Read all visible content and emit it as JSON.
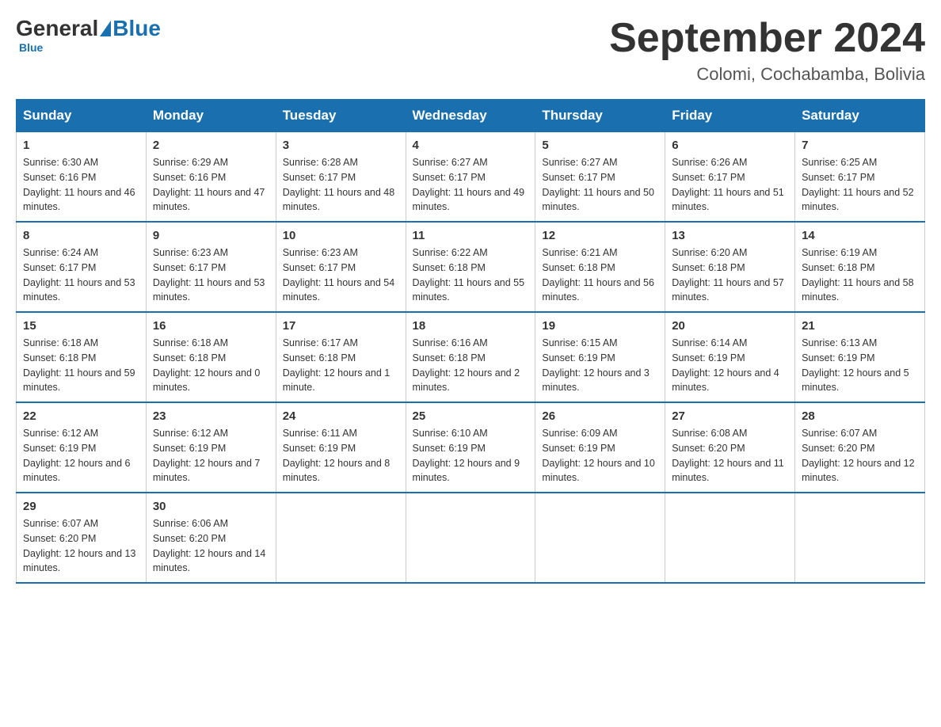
{
  "header": {
    "logo": {
      "general": "General",
      "blue": "Blue"
    },
    "title": "September 2024",
    "subtitle": "Colomi, Cochabamba, Bolivia"
  },
  "columns": [
    "Sunday",
    "Monday",
    "Tuesday",
    "Wednesday",
    "Thursday",
    "Friday",
    "Saturday"
  ],
  "weeks": [
    [
      {
        "day": "1",
        "sunrise": "6:30 AM",
        "sunset": "6:16 PM",
        "daylight": "11 hours and 46 minutes."
      },
      {
        "day": "2",
        "sunrise": "6:29 AM",
        "sunset": "6:16 PM",
        "daylight": "11 hours and 47 minutes."
      },
      {
        "day": "3",
        "sunrise": "6:28 AM",
        "sunset": "6:17 PM",
        "daylight": "11 hours and 48 minutes."
      },
      {
        "day": "4",
        "sunrise": "6:27 AM",
        "sunset": "6:17 PM",
        "daylight": "11 hours and 49 minutes."
      },
      {
        "day": "5",
        "sunrise": "6:27 AM",
        "sunset": "6:17 PM",
        "daylight": "11 hours and 50 minutes."
      },
      {
        "day": "6",
        "sunrise": "6:26 AM",
        "sunset": "6:17 PM",
        "daylight": "11 hours and 51 minutes."
      },
      {
        "day": "7",
        "sunrise": "6:25 AM",
        "sunset": "6:17 PM",
        "daylight": "11 hours and 52 minutes."
      }
    ],
    [
      {
        "day": "8",
        "sunrise": "6:24 AM",
        "sunset": "6:17 PM",
        "daylight": "11 hours and 53 minutes."
      },
      {
        "day": "9",
        "sunrise": "6:23 AM",
        "sunset": "6:17 PM",
        "daylight": "11 hours and 53 minutes."
      },
      {
        "day": "10",
        "sunrise": "6:23 AM",
        "sunset": "6:17 PM",
        "daylight": "11 hours and 54 minutes."
      },
      {
        "day": "11",
        "sunrise": "6:22 AM",
        "sunset": "6:18 PM",
        "daylight": "11 hours and 55 minutes."
      },
      {
        "day": "12",
        "sunrise": "6:21 AM",
        "sunset": "6:18 PM",
        "daylight": "11 hours and 56 minutes."
      },
      {
        "day": "13",
        "sunrise": "6:20 AM",
        "sunset": "6:18 PM",
        "daylight": "11 hours and 57 minutes."
      },
      {
        "day": "14",
        "sunrise": "6:19 AM",
        "sunset": "6:18 PM",
        "daylight": "11 hours and 58 minutes."
      }
    ],
    [
      {
        "day": "15",
        "sunrise": "6:18 AM",
        "sunset": "6:18 PM",
        "daylight": "11 hours and 59 minutes."
      },
      {
        "day": "16",
        "sunrise": "6:18 AM",
        "sunset": "6:18 PM",
        "daylight": "12 hours and 0 minutes."
      },
      {
        "day": "17",
        "sunrise": "6:17 AM",
        "sunset": "6:18 PM",
        "daylight": "12 hours and 1 minute."
      },
      {
        "day": "18",
        "sunrise": "6:16 AM",
        "sunset": "6:18 PM",
        "daylight": "12 hours and 2 minutes."
      },
      {
        "day": "19",
        "sunrise": "6:15 AM",
        "sunset": "6:19 PM",
        "daylight": "12 hours and 3 minutes."
      },
      {
        "day": "20",
        "sunrise": "6:14 AM",
        "sunset": "6:19 PM",
        "daylight": "12 hours and 4 minutes."
      },
      {
        "day": "21",
        "sunrise": "6:13 AM",
        "sunset": "6:19 PM",
        "daylight": "12 hours and 5 minutes."
      }
    ],
    [
      {
        "day": "22",
        "sunrise": "6:12 AM",
        "sunset": "6:19 PM",
        "daylight": "12 hours and 6 minutes."
      },
      {
        "day": "23",
        "sunrise": "6:12 AM",
        "sunset": "6:19 PM",
        "daylight": "12 hours and 7 minutes."
      },
      {
        "day": "24",
        "sunrise": "6:11 AM",
        "sunset": "6:19 PM",
        "daylight": "12 hours and 8 minutes."
      },
      {
        "day": "25",
        "sunrise": "6:10 AM",
        "sunset": "6:19 PM",
        "daylight": "12 hours and 9 minutes."
      },
      {
        "day": "26",
        "sunrise": "6:09 AM",
        "sunset": "6:19 PM",
        "daylight": "12 hours and 10 minutes."
      },
      {
        "day": "27",
        "sunrise": "6:08 AM",
        "sunset": "6:20 PM",
        "daylight": "12 hours and 11 minutes."
      },
      {
        "day": "28",
        "sunrise": "6:07 AM",
        "sunset": "6:20 PM",
        "daylight": "12 hours and 12 minutes."
      }
    ],
    [
      {
        "day": "29",
        "sunrise": "6:07 AM",
        "sunset": "6:20 PM",
        "daylight": "12 hours and 13 minutes."
      },
      {
        "day": "30",
        "sunrise": "6:06 AM",
        "sunset": "6:20 PM",
        "daylight": "12 hours and 14 minutes."
      },
      null,
      null,
      null,
      null,
      null
    ]
  ]
}
